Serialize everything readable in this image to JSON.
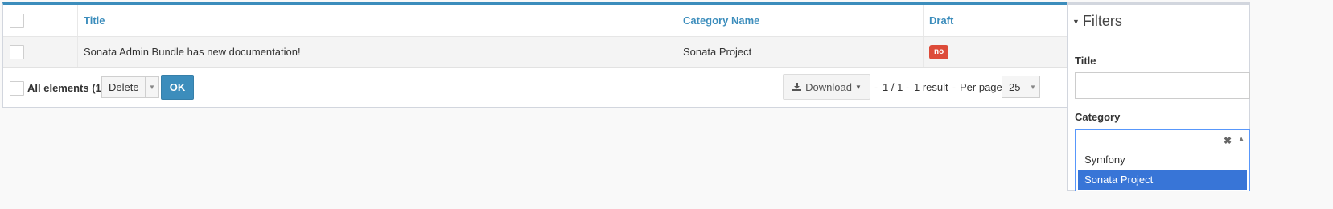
{
  "table": {
    "headers": {
      "title": "Title",
      "category": "Category Name",
      "draft": "Draft"
    },
    "rows": [
      {
        "title": "Sonata Admin Bundle has new documentation!",
        "category": "Sonata Project",
        "draft": "no"
      }
    ]
  },
  "footer": {
    "all_elements_label": "All elements (1)",
    "batch_action": "Delete",
    "ok_label": "OK",
    "download_label": "Download",
    "pager_dash1": "-",
    "pager_pages": "1 / 1",
    "pager_dash2": "-",
    "pager_results": "1 result",
    "pager_dash3": "-",
    "per_page_label": "Per page",
    "per_page_value": "25"
  },
  "filters": {
    "title": "Filters",
    "title_field_label": "Title",
    "title_field_value": "",
    "category_label": "Category",
    "category_value": "",
    "category_options": [
      "Symfony",
      "Sonata Project"
    ],
    "category_highlighted": "Sonata Project"
  },
  "colors": {
    "accent": "#3c8dbc",
    "danger": "#dd4b39",
    "highlight": "#3875d7"
  }
}
